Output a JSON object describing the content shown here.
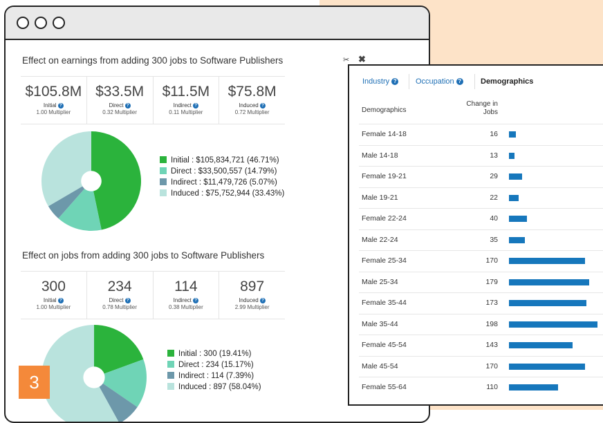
{
  "colors": {
    "initial": "#2bb33c",
    "direct": "#6fd4b6",
    "indirect": "#6d98aa",
    "induced": "#b9e3dd",
    "bar": "#1677bc",
    "accent": "#f4893a"
  },
  "earnings": {
    "title": "Effect on earnings from adding 300 jobs to Software Publishers",
    "stats": [
      {
        "value": "$105.8M",
        "label": "Initial",
        "multiplier": "1.00 Multiplier"
      },
      {
        "value": "$33.5M",
        "label": "Direct",
        "multiplier": "0.32 Multiplier"
      },
      {
        "value": "$11.5M",
        "label": "Indirect",
        "multiplier": "0.11 Multiplier"
      },
      {
        "value": "$75.8M",
        "label": "Induced",
        "multiplier": "0.72 Multiplier"
      }
    ],
    "legend": [
      {
        "text": "Initial : $105,834,721 (46.71%)",
        "pct": 46.71
      },
      {
        "text": "Direct : $33,500,557 (14.79%)",
        "pct": 14.79
      },
      {
        "text": "Indirect : $11,479,726 (5.07%)",
        "pct": 5.07
      },
      {
        "text": "Induced : $75,752,944 (33.43%)",
        "pct": 33.43
      }
    ]
  },
  "jobs": {
    "title": "Effect on jobs from adding 300 jobs to Software Publishers",
    "stats": [
      {
        "value": "300",
        "label": "Initial",
        "multiplier": "1.00 Multiplier"
      },
      {
        "value": "234",
        "label": "Direct",
        "multiplier": "0.78 Multiplier"
      },
      {
        "value": "114",
        "label": "Indirect",
        "multiplier": "0.38 Multiplier"
      },
      {
        "value": "897",
        "label": "Induced",
        "multiplier": "2.99 Multiplier"
      }
    ],
    "legend": [
      {
        "text": "Initial : 300 (19.41%)",
        "pct": 19.41
      },
      {
        "text": "Direct : 234 (15.17%)",
        "pct": 15.17
      },
      {
        "text": "Indirect : 114 (7.39%)",
        "pct": 7.39
      },
      {
        "text": "Induced : 897 (58.04%)",
        "pct": 58.04
      }
    ]
  },
  "badge": "3",
  "icons": {
    "scissors": "scissors-icon",
    "close": "close-icon",
    "help": "help-icon"
  },
  "panel": {
    "tabs": [
      {
        "label": "Industry",
        "help": true
      },
      {
        "label": "Occupation",
        "help": true
      },
      {
        "label": "Demographics",
        "help": false
      }
    ],
    "col_name": "Demographics",
    "col_change": "Change in Jobs",
    "max_value": 198,
    "rows": [
      {
        "name": "Female 14-18",
        "value": 16
      },
      {
        "name": "Male 14-18",
        "value": 13
      },
      {
        "name": "Female 19-21",
        "value": 29
      },
      {
        "name": "Male 19-21",
        "value": 22
      },
      {
        "name": "Female 22-24",
        "value": 40
      },
      {
        "name": "Male 22-24",
        "value": 35
      },
      {
        "name": "Female 25-34",
        "value": 170
      },
      {
        "name": "Male 25-34",
        "value": 179
      },
      {
        "name": "Female 35-44",
        "value": 173
      },
      {
        "name": "Male 35-44",
        "value": 198
      },
      {
        "name": "Female 45-54",
        "value": 143
      },
      {
        "name": "Male 45-54",
        "value": 170
      },
      {
        "name": "Female 55-64",
        "value": 110
      }
    ]
  }
}
